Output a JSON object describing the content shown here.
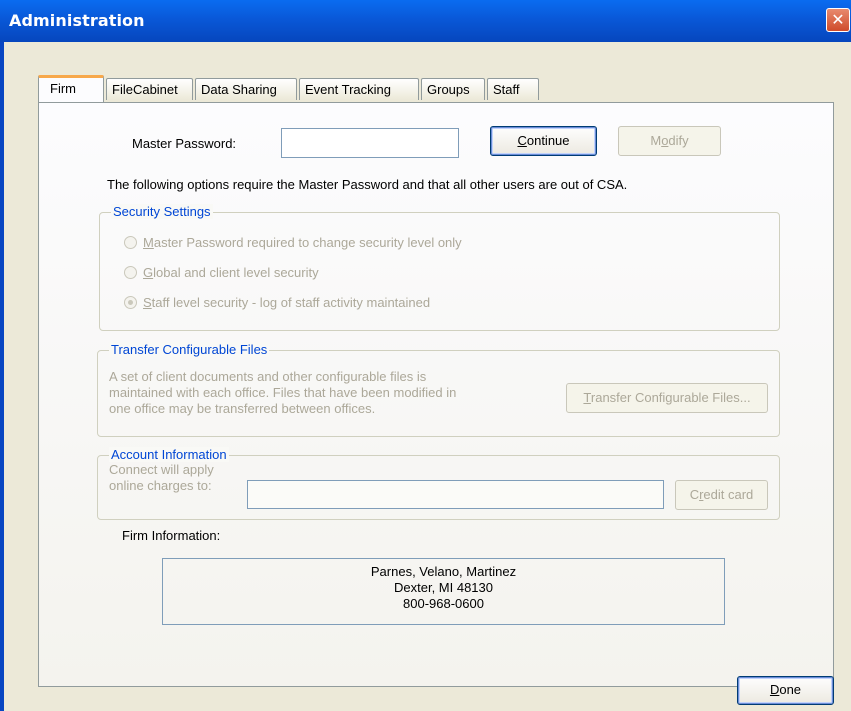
{
  "window": {
    "title": "Administration",
    "close_glyph": "✕"
  },
  "tabs": [
    {
      "label": "Firm"
    },
    {
      "label": "FileCabinet"
    },
    {
      "label": "Data Sharing"
    },
    {
      "label": "Event Tracking"
    },
    {
      "label": "Groups"
    },
    {
      "label": "Staff"
    }
  ],
  "password": {
    "label": "Master Password:",
    "value": "",
    "continue_label_u": "C",
    "continue_label_rest": "ontinue",
    "modify_label_pre": "M",
    "modify_label_u": "o",
    "modify_label_rest": "dify"
  },
  "notice": "The following options require the Master Password and that all other users are out of CSA.",
  "security": {
    "title": "Security Settings",
    "options": [
      {
        "u": "M",
        "rest": "aster Password required to change security level only",
        "selected": false
      },
      {
        "u": "G",
        "rest": "lobal and client level security",
        "selected": false
      },
      {
        "u": "S",
        "rest": "taff level security - log of staff activity maintained",
        "selected": true
      }
    ]
  },
  "transfer": {
    "title": "Transfer Configurable Files",
    "description_lines": [
      "A set of client documents and other configurable files is",
      "maintained with each office.  Files that have been modified in",
      "one office may be transferred between offices."
    ],
    "button_u": "T",
    "button_rest": "ransfer Configurable Files..."
  },
  "account": {
    "title": "Account Information",
    "label_lines": [
      "Connect will apply",
      "online charges to:"
    ],
    "value": "",
    "button_pre": "C",
    "button_u": "r",
    "button_rest": "edit card"
  },
  "firm_info": {
    "label": "Firm Information:",
    "lines": [
      "Parnes, Velano, Martinez",
      "Dexter, MI 48130",
      "800-968-0600"
    ]
  },
  "footer": {
    "done_u": "D",
    "done_rest": "one"
  },
  "colors": {
    "titlebar": "#0958d8",
    "group_title": "#0046d5",
    "disabled_text": "#aca899",
    "tab_highlight": "#f7a84b"
  }
}
